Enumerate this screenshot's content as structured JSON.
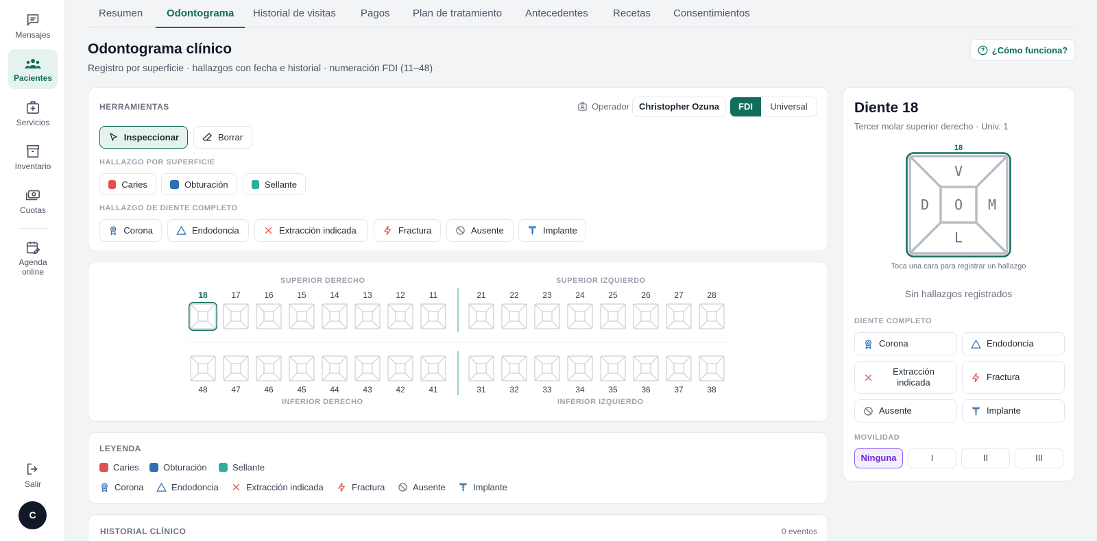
{
  "sidebar": {
    "items": [
      {
        "label": "Mensajes",
        "icon": "message-icon",
        "active": false
      },
      {
        "label": "Pacientes",
        "icon": "users-icon",
        "active": true
      },
      {
        "label": "Servicios",
        "icon": "medical-kit-icon",
        "active": false
      },
      {
        "label": "Inventario",
        "icon": "archive-icon",
        "active": false
      },
      {
        "label": "Cuotas",
        "icon": "money-icon",
        "active": false
      },
      {
        "label": "Agenda online",
        "icon": "calendar-edit-icon",
        "active": false
      }
    ],
    "logout_label": "Salir",
    "avatar_initial": "C"
  },
  "tabs": [
    "Resumen",
    "Odontograma",
    "Historial de visitas",
    "Pagos",
    "Plan de tratamiento",
    "Antecedentes",
    "Recetas",
    "Consentimientos"
  ],
  "active_tab": "Odontograma",
  "header": {
    "title": "Odontograma clínico",
    "subtitle": "Registro por superficie · hallazgos con fecha e historial · numeración FDI (11–48)",
    "help_label": "¿Cómo funciona?"
  },
  "tools": {
    "title": "HERRAMIENTAS",
    "operator_label": "Operador",
    "operator_name": "Christopher Ozuna",
    "numbering": {
      "options": [
        "FDI",
        "Universal"
      ],
      "selected": "FDI"
    },
    "modes": [
      {
        "label": "Inspeccionar",
        "icon": "cursor-icon",
        "active": true
      },
      {
        "label": "Borrar",
        "icon": "eraser-icon",
        "active": false
      }
    ],
    "surface_title": "HALLAZGO POR SUPERFICIE",
    "surface_findings": [
      {
        "label": "Caries",
        "color": "#e05252"
      },
      {
        "label": "Obturación",
        "color": "#2f6fb0"
      },
      {
        "label": "Sellante",
        "color": "#2fae9c"
      }
    ],
    "whole_title": "HALLAZGO DE DIENTE COMPLETO",
    "whole_findings": [
      {
        "label": "Corona",
        "icon": "crown-icon"
      },
      {
        "label": "Endodoncia",
        "icon": "triangle-icon"
      },
      {
        "label": "Extracción indicada",
        "icon": "x-icon"
      },
      {
        "label": "Fractura",
        "icon": "lightning-icon"
      },
      {
        "label": "Ausente",
        "icon": "ban-icon"
      },
      {
        "label": "Implante",
        "icon": "implant-icon"
      }
    ]
  },
  "chart": {
    "quadrants": {
      "upper_right": "SUPERIOR DERECHO",
      "upper_left": "SUPERIOR IZQUIERDO",
      "lower_right": "INFERIOR DERECHO",
      "lower_left": "INFERIOR IZQUIERDO"
    },
    "upper": [
      "18",
      "17",
      "16",
      "15",
      "14",
      "13",
      "12",
      "11",
      "21",
      "22",
      "23",
      "24",
      "25",
      "26",
      "27",
      "28"
    ],
    "lower": [
      "48",
      "47",
      "46",
      "45",
      "44",
      "43",
      "42",
      "41",
      "31",
      "32",
      "33",
      "34",
      "35",
      "36",
      "37",
      "38"
    ],
    "selected": "18"
  },
  "legend": {
    "title": "LEYENDA",
    "surface": [
      {
        "label": "Caries",
        "color": "#e05252"
      },
      {
        "label": "Obturación",
        "color": "#2f6fb0"
      },
      {
        "label": "Sellante",
        "color": "#2fae9c"
      }
    ],
    "whole": [
      {
        "label": "Corona",
        "icon": "crown-icon"
      },
      {
        "label": "Endodoncia",
        "icon": "triangle-icon"
      },
      {
        "label": "Extracción indicada",
        "icon": "x-icon"
      },
      {
        "label": "Fractura",
        "icon": "lightning-icon"
      },
      {
        "label": "Ausente",
        "icon": "ban-icon"
      },
      {
        "label": "Implante",
        "icon": "implant-icon"
      }
    ]
  },
  "history": {
    "title": "HISTORIAL CLÍNICO",
    "count": "0 eventos"
  },
  "detail": {
    "title": "Diente 18",
    "subtitle": "Tercer molar superior derecho · Univ. 1",
    "tooth_number": "18",
    "faces": {
      "top": "V",
      "left": "D",
      "center": "O",
      "right": "M",
      "bottom": "L"
    },
    "hint": "Toca una cara para registrar un hallazgo",
    "empty": "Sin hallazgos registrados",
    "whole_title": "DIENTE COMPLETO",
    "whole_buttons": [
      {
        "label": "Corona",
        "icon": "crown-icon"
      },
      {
        "label": "Endodoncia",
        "icon": "triangle-icon"
      },
      {
        "label": "Extracción indicada",
        "icon": "x-icon"
      },
      {
        "label": "Fractura",
        "icon": "lightning-icon"
      },
      {
        "label": "Ausente",
        "icon": "ban-icon"
      },
      {
        "label": "Implante",
        "icon": "implant-icon"
      }
    ],
    "mobility_title": "MOVILIDAD",
    "mobility": [
      "Ninguna",
      "I",
      "II",
      "III"
    ],
    "mobility_selected": "Ninguna"
  },
  "colors": {
    "accent": "#0f6e5c",
    "accent_bg": "#e6f2ee",
    "purple": "#6d28d9"
  }
}
